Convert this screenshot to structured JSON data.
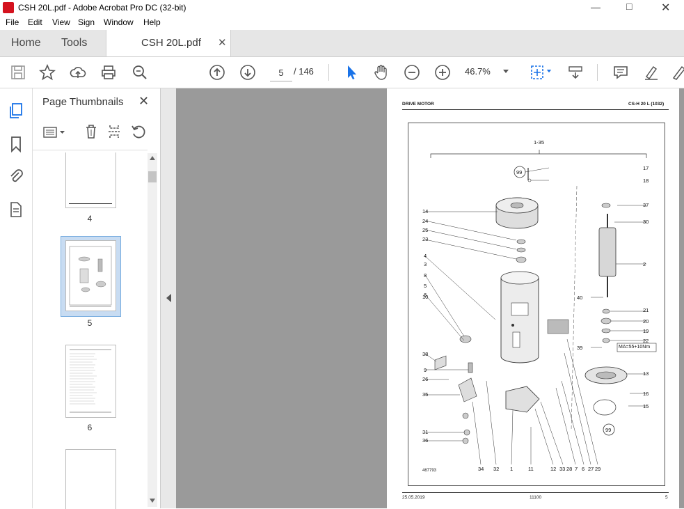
{
  "window": {
    "title": "CSH 20L.pdf - Adobe Acrobat Pro DC (32-bit)"
  },
  "menu": [
    "File",
    "Edit",
    "View",
    "Sign",
    "Window",
    "Help"
  ],
  "tabs": {
    "home": "Home",
    "tools": "Tools",
    "document": "CSH 20L.pdf"
  },
  "toolbar": {
    "current_page": "5",
    "page_total": "/  146",
    "zoom": "46.7%"
  },
  "thumbnails": {
    "title": "Page Thumbnails",
    "pages": [
      "4",
      "5",
      "6"
    ]
  },
  "document": {
    "header_left": "DRIVE MOTOR",
    "header_right": "CS-H 20 L (1032)",
    "footer_left": "25.05.2019",
    "footer_center": "11100",
    "footer_right": "5",
    "range_label": "1-35",
    "torque_label": "MA=55+10Nm",
    "drawing_number": "467793",
    "callouts_left": [
      "14",
      "24",
      "25",
      "23",
      "4",
      "3",
      "8",
      "5",
      "6",
      "10",
      "38",
      "9",
      "26",
      "35",
      "31",
      "36"
    ],
    "callouts_right": [
      "17",
      "18",
      "37",
      "30",
      "2",
      "40",
      "21",
      "20",
      "19",
      "22",
      "39",
      "13",
      "16",
      "15"
    ],
    "callouts_bottom": [
      "34",
      "32",
      "1",
      "11",
      "12",
      "33",
      "28",
      "7",
      "6",
      "27",
      "29"
    ],
    "circle_99": "99"
  },
  "colors": {
    "accent_blue": "#1a73e8",
    "acrobat_red": "#d4121e",
    "doc_background": "#9a9a9a"
  }
}
